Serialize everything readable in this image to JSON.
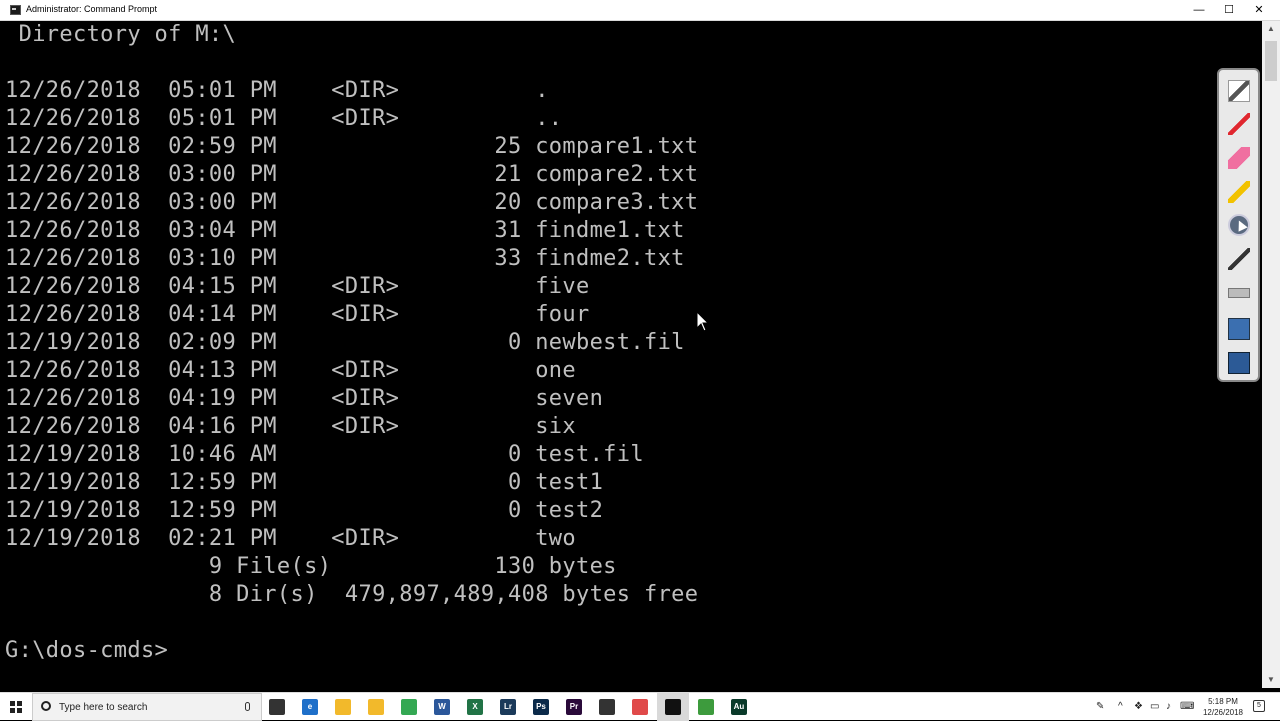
{
  "window": {
    "title": "Administrator: Command Prompt",
    "minimize_label": "—",
    "maximize_label": "☐",
    "close_label": "✕"
  },
  "console": {
    "lines": [
      " Directory of M:\\",
      "",
      "12/26/2018  05:01 PM    <DIR>          .",
      "12/26/2018  05:01 PM    <DIR>          ..",
      "12/26/2018  02:59 PM                25 compare1.txt",
      "12/26/2018  03:00 PM                21 compare2.txt",
      "12/26/2018  03:00 PM                20 compare3.txt",
      "12/26/2018  03:04 PM                31 findme1.txt",
      "12/26/2018  03:10 PM                33 findme2.txt",
      "12/26/2018  04:15 PM    <DIR>          five",
      "12/26/2018  04:14 PM    <DIR>          four",
      "12/19/2018  02:09 PM                 0 newbest.fil",
      "12/26/2018  04:13 PM    <DIR>          one",
      "12/26/2018  04:19 PM    <DIR>          seven",
      "12/26/2018  04:16 PM    <DIR>          six",
      "12/19/2018  10:46 AM                 0 test.fil",
      "12/19/2018  12:59 PM                 0 test1",
      "12/19/2018  12:59 PM                 0 test2",
      "12/19/2018  02:21 PM    <DIR>          two",
      "               9 File(s)            130 bytes",
      "               8 Dir(s)  479,897,489,408 bytes free",
      "",
      "G:\\dos-cmds>"
    ]
  },
  "toolbar_tools": [
    "pencil-icon",
    "pen-icon",
    "eraser-icon",
    "highlighter-icon",
    "pointer-icon",
    "brush-icon",
    "ruler-icon",
    "screen-icon",
    "screen-capture-icon"
  ],
  "taskbar": {
    "search_placeholder": "Type here to search",
    "apps": [
      {
        "name": "task-view-icon",
        "label": "",
        "color": "#333333"
      },
      {
        "name": "edge-icon",
        "label": "e",
        "color": "#1e6fc9"
      },
      {
        "name": "file-explorer-icon",
        "label": "",
        "color": "#f2b92b"
      },
      {
        "name": "store-icon",
        "label": "",
        "color": "#f2b92b"
      },
      {
        "name": "chrome-icon",
        "label": "",
        "color": "#34a853"
      },
      {
        "name": "word-icon",
        "label": "W",
        "color": "#2b579a"
      },
      {
        "name": "excel-icon",
        "label": "X",
        "color": "#217346"
      },
      {
        "name": "lightroom-icon",
        "label": "Lr",
        "color": "#1b3a5a"
      },
      {
        "name": "photoshop-icon",
        "label": "Ps",
        "color": "#0b2a4a"
      },
      {
        "name": "premiere-icon",
        "label": "Pr",
        "color": "#2a0a3a"
      },
      {
        "name": "screencast-icon",
        "label": "",
        "color": "#333333"
      },
      {
        "name": "record-icon",
        "label": "",
        "color": "#e04a4a"
      },
      {
        "name": "command-prompt-icon",
        "label": "",
        "color": "#111111"
      },
      {
        "name": "notepad-icon",
        "label": "",
        "color": "#3d9b3d"
      },
      {
        "name": "audition-icon",
        "label": "Au",
        "color": "#0a3a2a"
      }
    ],
    "time": "5:18 PM",
    "date": "12/26/2018",
    "notification_count": "5"
  }
}
